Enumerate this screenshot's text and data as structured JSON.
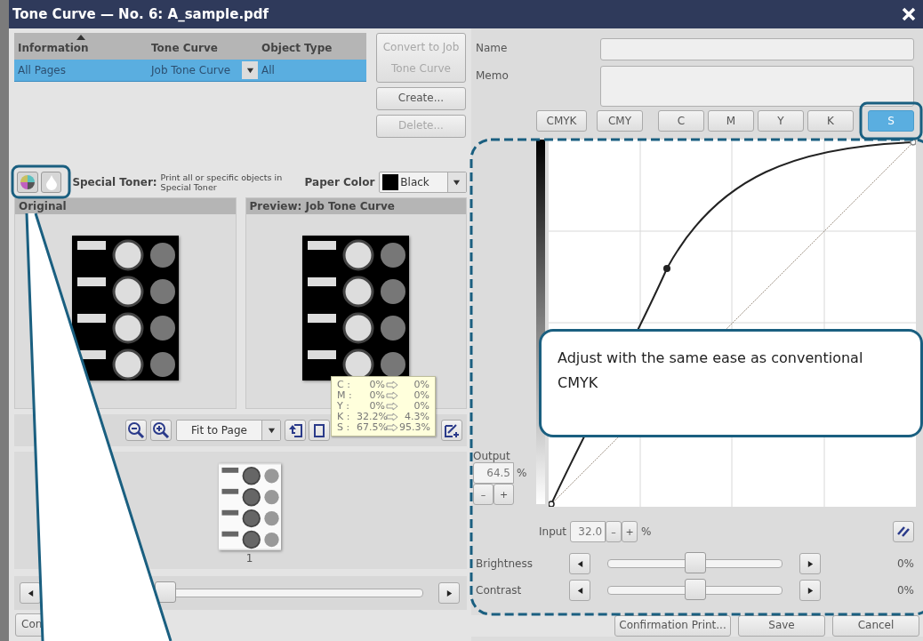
{
  "window": {
    "title": "Tone Curve — No. 6: A_sample.pdf"
  },
  "object_table": {
    "columns": [
      {
        "label": "Information",
        "sorted": true
      },
      {
        "label": "Tone Curve",
        "sorted": false
      },
      {
        "label": "Object Type",
        "sorted": false
      }
    ],
    "rows": [
      {
        "information": "All Pages",
        "tone_curve": "Job Tone Curve",
        "object_type": "All",
        "selected": true
      }
    ]
  },
  "table_buttons": [
    {
      "label": "Convert to Job Tone Curve",
      "disabled": true
    },
    {
      "label": "Create...",
      "disabled": false
    },
    {
      "label": "Delete...",
      "disabled": true
    }
  ],
  "special_toner": {
    "label": "Special Toner:",
    "hint": "Print all or specific objects in Special Toner"
  },
  "paper_color": {
    "label": "Paper Color",
    "value": "Black"
  },
  "previews": [
    {
      "title": "Original"
    },
    {
      "title": "Preview: Job Tone Curve"
    }
  ],
  "tooltip": {
    "rows": [
      {
        "channel": "C :",
        "from": "0%",
        "to": "0%"
      },
      {
        "channel": "M :",
        "from": "0%",
        "to": "0%"
      },
      {
        "channel": "Y :",
        "from": "0%",
        "to": "0%"
      },
      {
        "channel": "K :",
        "from": "32.2%",
        "to": "4.3%"
      },
      {
        "channel": "S :",
        "from": "67.5%",
        "to": "95.3%"
      }
    ]
  },
  "zoom": {
    "value": "Fit to Page"
  },
  "thumbnails": [
    {
      "page": "1"
    }
  ],
  "page_slider": {
    "level": 0.3
  },
  "footer_left_button": {
    "label": "Con"
  },
  "name_field": {
    "label": "Name"
  },
  "memo_field": {
    "label": "Memo"
  },
  "channel_buttons": [
    {
      "label": "CMYK",
      "selected": false
    },
    {
      "label": "CMY",
      "selected": false
    },
    {
      "label": "C",
      "selected": false
    },
    {
      "label": "M",
      "selected": false
    },
    {
      "label": "Y",
      "selected": false
    },
    {
      "label": "K",
      "selected": false
    },
    {
      "label": "S",
      "selected": true
    }
  ],
  "output": {
    "label": "Output",
    "value": "64.5",
    "unit": "%",
    "minus": "–",
    "plus": "+"
  },
  "input": {
    "label": "Input",
    "value": "32.0",
    "unit": "%",
    "minus": "–",
    "plus": "+"
  },
  "adjustments": [
    {
      "label": "Brightness",
      "level": 0.5,
      "reading": "0%"
    },
    {
      "label": "Contrast",
      "level": 0.5,
      "reading": "0%"
    }
  ],
  "footer_buttons": [
    "Confirmation Print...",
    "Save",
    "Cancel"
  ],
  "callout": {
    "text": "Adjust with the same ease as conventional CMYK"
  }
}
